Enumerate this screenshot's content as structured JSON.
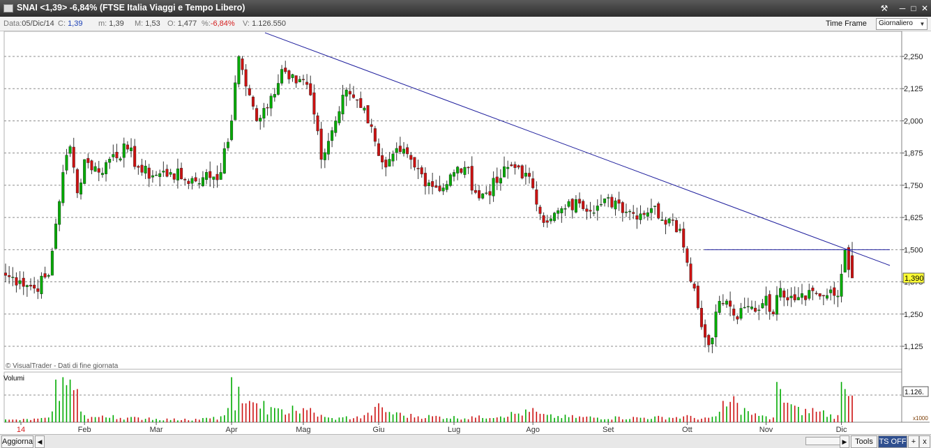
{
  "window": {
    "title": "SNAI <1,39> -6,84%  (FTSE Italia Viaggi e Tempo Libero)"
  },
  "infobar": {
    "date_label": "Data:",
    "date_value": "05/Dic/14",
    "close_label": "C:",
    "close_value": "1,39",
    "low_label": "m:",
    "low_value": "1,39",
    "high_label": "M:",
    "high_value": "1,53",
    "open_label": "O:",
    "open_value": "1,477",
    "pct_label": "%:",
    "pct_value": "-6,84%",
    "vol_label": "V:",
    "vol_value": "1.126.550",
    "timeframe_label": "Time Frame",
    "timeframe_value": "Giornaliero"
  },
  "bottombar": {
    "refresh_label": "Aggiorna",
    "tools_label": "Tools",
    "ts_label": "TS OFF",
    "plus_label": "+",
    "x_label": "x"
  },
  "colors": {
    "up": "#00aa00",
    "down": "#cc1111",
    "trendline": "#1c1c9c",
    "grid": "#8c8c8c",
    "last_price_bg": "#ffff33"
  },
  "chart_data": {
    "type": "candlestick",
    "copyright": "© VisualTrader - Dati di fine giornata",
    "volume_label": "Volumi",
    "volume_last_label": "1.126.",
    "volume_unit": "x1000",
    "last_price_label": "1,390",
    "y_ticks": [
      "2,250",
      "2,125",
      "2,000",
      "1,875",
      "1,750",
      "1,625",
      "1,500",
      "1,375",
      "1,250",
      "1,125"
    ],
    "y_tick_values": [
      2.25,
      2.125,
      2.0,
      1.875,
      1.75,
      1.625,
      1.5,
      1.375,
      1.25,
      1.125
    ],
    "ylim": [
      1.07,
      2.35
    ],
    "volume_ylim": [
      0,
      2000
    ],
    "x_labels": [
      "14",
      "Feb",
      "Mar",
      "Apr",
      "Mag",
      "Giu",
      "Lug",
      "Ago",
      "Set",
      "Ott",
      "Nov",
      "Dic"
    ],
    "x_label_days": [
      0,
      22,
      42,
      63,
      83,
      104,
      125,
      147,
      168,
      190,
      212,
      233
    ],
    "first_label_color": "#d41e1e",
    "anchors_days": [
      0,
      4,
      8,
      12,
      14,
      16,
      18,
      20,
      22,
      26,
      30,
      34,
      38,
      42,
      46,
      50,
      55,
      60,
      63,
      65,
      68,
      70,
      73,
      77,
      80,
      83,
      85,
      88,
      92,
      95,
      98,
      100,
      103,
      106,
      110,
      114,
      118,
      122,
      125,
      128,
      132,
      137,
      140,
      143,
      147,
      149,
      152,
      156,
      160,
      165,
      170,
      175,
      180,
      185,
      188,
      190,
      192,
      194,
      196,
      199,
      202,
      204,
      207,
      209,
      212,
      214,
      216,
      219,
      222,
      225,
      228,
      232,
      234,
      236
    ],
    "anchors_close": [
      1.4,
      1.38,
      1.35,
      1.4,
      1.6,
      1.8,
      1.9,
      1.72,
      1.85,
      1.8,
      1.87,
      1.89,
      1.8,
      1.79,
      1.8,
      1.77,
      1.78,
      1.8,
      2.0,
      2.25,
      2.1,
      2.0,
      2.05,
      2.2,
      2.18,
      2.16,
      2.1,
      1.85,
      2.0,
      2.12,
      2.08,
      2.05,
      1.92,
      1.82,
      1.88,
      1.82,
      1.76,
      1.74,
      1.8,
      1.82,
      1.7,
      1.76,
      1.82,
      1.82,
      1.74,
      1.64,
      1.62,
      1.66,
      1.68,
      1.67,
      1.69,
      1.64,
      1.66,
      1.62,
      1.58,
      1.45,
      1.35,
      1.2,
      1.13,
      1.3,
      1.28,
      1.23,
      1.28,
      1.26,
      1.32,
      1.25,
      1.35,
      1.32,
      1.33,
      1.34,
      1.32,
      1.32,
      1.5,
      1.39
    ],
    "volume_anchor_days": [
      0,
      12,
      14,
      15,
      16,
      18,
      20,
      22,
      30,
      40,
      50,
      60,
      62,
      63,
      64,
      65,
      66,
      68,
      70,
      72,
      75,
      80,
      85,
      90,
      95,
      100,
      104,
      110,
      130,
      147,
      150,
      170,
      190,
      195,
      198,
      200,
      203,
      206,
      212,
      214,
      215,
      216,
      220,
      225,
      228,
      232,
      233,
      234,
      236
    ],
    "volume_anchor_values": [
      120,
      200,
      1800,
      900,
      1900,
      1800,
      1400,
      300,
      300,
      200,
      150,
      250,
      600,
      1900,
      500,
      1500,
      800,
      900,
      800,
      900,
      600,
      700,
      600,
      200,
      250,
      300,
      800,
      400,
      250,
      600,
      350,
      250,
      300,
      200,
      250,
      900,
      1100,
      600,
      250,
      200,
      1700,
      1400,
      700,
      600,
      500,
      300,
      1700,
      1400,
      1126
    ]
  }
}
